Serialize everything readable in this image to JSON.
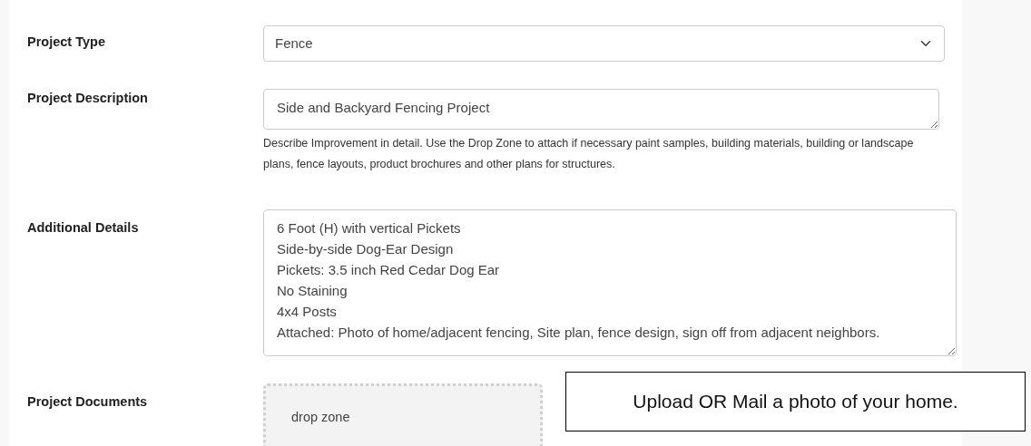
{
  "fields": [
    {
      "kind": "select",
      "label": "Project Type",
      "value": "Fence"
    },
    {
      "kind": "textarea",
      "label": "Project Description",
      "value": "Side and Backyard Fencing Project",
      "help": "Describe Improvement in detail. Use the Drop Zone to attach if necessary paint samples, building materials, building or landscape plans, fence layouts, product brochures and other plans for structures."
    },
    {
      "kind": "textarea",
      "label": "Additional Details",
      "lines": [
        "6 Foot (H) with vertical Pickets",
        "Side-by-side Dog-Ear Design",
        "Pickets: 3.5 inch Red Cedar Dog Ear",
        "No Staining",
        "4x4 Posts",
        "Attached: Photo of home/adjacent fencing, Site plan, fence design, sign off from adjacent neighbors."
      ]
    },
    {
      "kind": "dropzone",
      "label": "Project Documents",
      "placeholder": "drop zone"
    }
  ],
  "callout": "Upload OR Mail a photo of your home."
}
